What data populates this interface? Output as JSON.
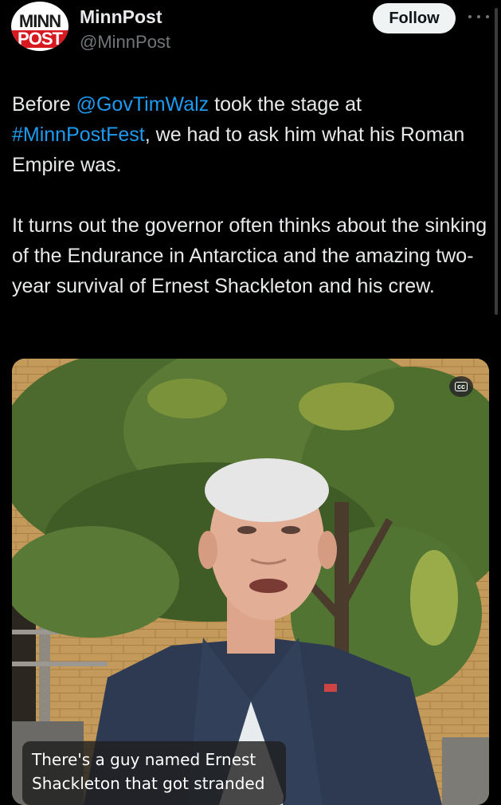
{
  "account": {
    "display_name": "MinnPost",
    "handle": "@MinnPost",
    "avatar_line1": "MINN",
    "avatar_line2": "POST"
  },
  "follow_label": "Follow",
  "tweet": {
    "p1_before": "Before ",
    "p1_mention": "@GovTimWalz",
    "p1_mid": " took the stage at ",
    "p1_hashtag": "#MinnPostFest",
    "p1_after": ", we had to ask him what his Roman Empire was.",
    "p2": "It turns out the governor often thinks about the sinking of the Endurance in Antarctica and the amazing two-year survival of Ernest Shackleton and his crew."
  },
  "video": {
    "cc_label": "cc",
    "caption_line1": "There's a guy named Ernest",
    "caption_line2": "Shackleton that got stranded"
  },
  "colors": {
    "background": "#000000",
    "link": "#1d9bf0",
    "text": "#e7e9ea",
    "muted": "#71767b",
    "brand_red": "#d71920"
  }
}
